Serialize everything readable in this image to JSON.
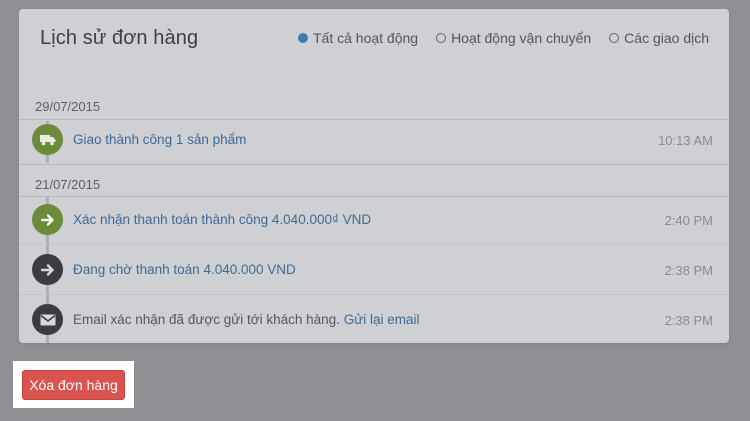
{
  "order_history": {
    "title": "Lịch sử đơn hàng",
    "filters": [
      {
        "label": "Tất cả hoạt động",
        "selected": true
      },
      {
        "label": "Hoạt động vận chuyển",
        "selected": false
      },
      {
        "label": "Các giao dịch",
        "selected": false
      }
    ],
    "groups": [
      {
        "date": "29/07/2015",
        "events": [
          {
            "icon": "truck-icon",
            "text": "Giao thành công 1 sản phẩm",
            "time": "10:13 AM"
          }
        ]
      },
      {
        "date": "21/07/2015",
        "events": [
          {
            "icon": "arrow-right-icon",
            "text": "Xác nhận thanh toán thành công 4.040.000₫ VND",
            "time": "2:40 PM"
          },
          {
            "icon": "arrow-right-icon",
            "text": "Đang chờ thanh toán 4.040.000 VND",
            "time": "2:38 PM"
          },
          {
            "icon": "envelope-icon",
            "text": "Email xác nhận đã được gửi tới khách hàng.",
            "link": "Gửi lại email",
            "time": "2:38 PM"
          }
        ]
      }
    ]
  },
  "actions": {
    "delete_order_label": "Xóa đơn hàng"
  },
  "colors": {
    "accent": "#3a7bb0",
    "success_icon": "#6d8a3a",
    "dark_icon": "#3b3c40",
    "danger": "#d9534f"
  }
}
